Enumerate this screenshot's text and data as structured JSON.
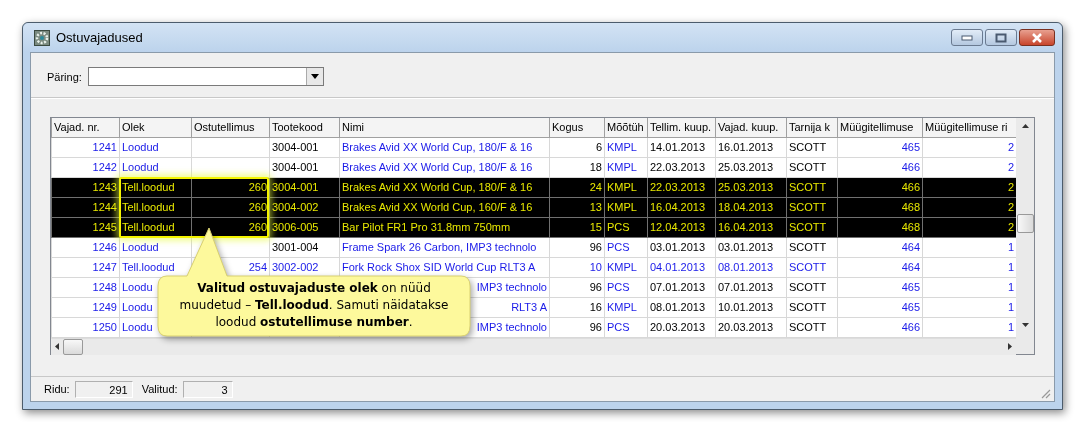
{
  "window": {
    "title": "Ostuvajadused"
  },
  "query": {
    "label": "Päring:"
  },
  "table": {
    "columns": [
      "Vajad. nr.",
      "Olek",
      "Ostutellimus",
      "Tootekood",
      "Nimi",
      "Kogus",
      "Mõõtüh",
      "Tellim. kuup.",
      "Vajad. kuup.",
      "Tarnija k",
      "Müügitellimuse",
      "Müügitellimuse ri"
    ],
    "rows": [
      {
        "selected": false,
        "emphasis": false,
        "covered": false,
        "vajad_nr": "1241",
        "olek": "Loodud",
        "tootekood": "3004-001",
        "nimi": "Brakes Avid XX World Cup, 180/F & 16",
        "kogus": "6",
        "mootuhik": "KMPL",
        "tellim_kuup": "14.01.2013",
        "vajad_kuup": "16.01.2013",
        "tarnija": "SCOTT",
        "myygi_nr": "465",
        "myygi_rida": "2"
      },
      {
        "selected": false,
        "emphasis": false,
        "covered": false,
        "vajad_nr": "1242",
        "olek": "Loodud",
        "tootekood": "3004-001",
        "nimi": "Brakes Avid XX World Cup, 180/F & 16",
        "kogus": "18",
        "mootuhik": "KMPL",
        "tellim_kuup": "22.03.2013",
        "vajad_kuup": "25.03.2013",
        "tarnija": "SCOTT",
        "myygi_nr": "466",
        "myygi_rida": "2"
      },
      {
        "selected": true,
        "emphasis": false,
        "covered": false,
        "vajad_nr": "1243",
        "olek": "Tell.loodud",
        "ostutellimus": "260",
        "tootekood": "3004-001",
        "nimi": "Brakes Avid XX World Cup, 180/F & 16",
        "kogus": "24",
        "mootuhik": "KMPL",
        "tellim_kuup": "22.03.2013",
        "vajad_kuup": "25.03.2013",
        "tarnija": "SCOTT",
        "myygi_nr": "466",
        "myygi_rida": "2"
      },
      {
        "selected": true,
        "emphasis": false,
        "covered": false,
        "vajad_nr": "1244",
        "olek": "Tell.loodud",
        "ostutellimus": "260",
        "tootekood": "3004-002",
        "nimi": "Brakes Avid XX World Cup, 160/F & 16",
        "kogus": "13",
        "mootuhik": "KMPL",
        "tellim_kuup": "16.04.2013",
        "vajad_kuup": "18.04.2013",
        "tarnija": "SCOTT",
        "myygi_nr": "468",
        "myygi_rida": "2"
      },
      {
        "selected": true,
        "emphasis": false,
        "covered": false,
        "vajad_nr": "1245",
        "olek": "Tell.loodud",
        "ostutellimus": "260",
        "tootekood": "3006-005",
        "nimi": "Bar Pilot FR1 Pro 31.8mm 750mm",
        "kogus": "15",
        "mootuhik": "PCS",
        "tellim_kuup": "12.04.2013",
        "vajad_kuup": "16.04.2013",
        "tarnija": "SCOTT",
        "myygi_nr": "468",
        "myygi_rida": "2"
      },
      {
        "selected": false,
        "emphasis": false,
        "covered": false,
        "vajad_nr": "1246",
        "olek": "Loodud",
        "tootekood": "3001-004",
        "nimi": "Frame Spark 26 Carbon, IMP3 technolo",
        "kogus": "96",
        "mootuhik": "PCS",
        "tellim_kuup": "03.01.2013",
        "vajad_kuup": "03.01.2013",
        "tarnija": "SCOTT",
        "myygi_nr": "464",
        "myygi_rida": "1"
      },
      {
        "selected": false,
        "emphasis": true,
        "covered": false,
        "vajad_nr": "1247",
        "olek": "Tell.loodud",
        "ostutellimus": "254",
        "tootekood": "3002-002",
        "nimi": "Fork Rock Shox SID World Cup RLT3 A",
        "kogus": "10",
        "mootuhik": "KMPL",
        "tellim_kuup": "04.01.2013",
        "vajad_kuup": "08.01.2013",
        "tarnija": "SCOTT",
        "myygi_nr": "464",
        "myygi_rida": "1"
      },
      {
        "selected": false,
        "emphasis": false,
        "covered": true,
        "vajad_nr": "1248",
        "olek": "Loodu",
        "nimi": "IMP3 technolo",
        "kogus": "96",
        "mootuhik": "PCS",
        "tellim_kuup": "07.01.2013",
        "vajad_kuup": "07.01.2013",
        "tarnija": "SCOTT",
        "myygi_nr": "465",
        "myygi_rida": "1"
      },
      {
        "selected": false,
        "emphasis": false,
        "covered": true,
        "vajad_nr": "1249",
        "olek": "Loodu",
        "nimi": "RLT3 A",
        "kogus": "16",
        "mootuhik": "KMPL",
        "tellim_kuup": "08.01.2013",
        "vajad_kuup": "10.01.2013",
        "tarnija": "SCOTT",
        "myygi_nr": "465",
        "myygi_rida": "1"
      },
      {
        "selected": false,
        "emphasis": false,
        "covered": true,
        "vajad_nr": "1250",
        "olek": "Loodu",
        "nimi": "IMP3 technolo",
        "kogus": "96",
        "mootuhik": "PCS",
        "tellim_kuup": "20.03.2013",
        "vajad_kuup": "20.03.2013",
        "tarnija": "SCOTT",
        "myygi_nr": "466",
        "myygi_rida": "1"
      }
    ]
  },
  "callout": {
    "text": "**Valitud ostuvajaduste olek** on nüüd muudetud – **Tell.loodud**. Samuti näidatakse loodud **ostutellimuse number**."
  },
  "status_bar": {
    "rows_label": "Ridu:",
    "rows_value": "291",
    "selected_label": "Valitud:",
    "selected_value": "3"
  }
}
